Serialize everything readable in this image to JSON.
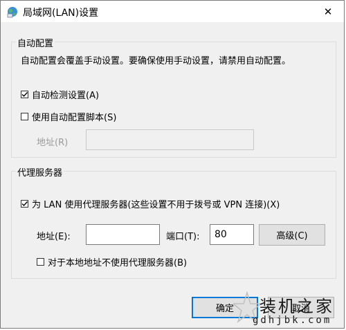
{
  "window": {
    "title": "局域网(LAN)设置",
    "close_symbol": "✕"
  },
  "auto_config": {
    "legend": "自动配置",
    "description": "自动配置会覆盖手动设置。要确保使用手动设置，请禁用自动配置。",
    "auto_detect": {
      "label": "自动检测设置(A)",
      "checked": true
    },
    "use_script": {
      "label": "使用自动配置脚本(S)",
      "checked": false
    },
    "address_label": "地址(R)",
    "address_value": ""
  },
  "proxy": {
    "legend": "代理服务器",
    "use_proxy": {
      "label": "为 LAN 使用代理服务器(这些设置不用于拨号或 VPN 连接)(X)",
      "checked": true
    },
    "address_label": "地址(E):",
    "address_value": "",
    "port_label": "端口(T):",
    "port_value": "80",
    "advanced_label": "高级(C)",
    "bypass_local": {
      "label": "对于本地地址不使用代理服务器(B)",
      "checked": false
    }
  },
  "buttons": {
    "ok": "确定",
    "cancel": "取消"
  },
  "watermark": {
    "text": "装机之家",
    "url": "gdhjbk.com"
  },
  "colors": {
    "accent": "#0078d7",
    "frame": "#f0f0f0"
  }
}
